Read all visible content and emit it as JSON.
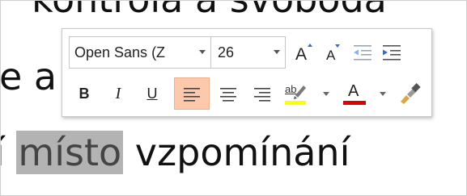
{
  "document": {
    "line1": "kontrola a svoboda",
    "line2": "e a",
    "line3_prefix": "í ",
    "line3_selected": "místo",
    "line3_suffix": " vzpomínání"
  },
  "mini_toolbar": {
    "font_name": "Open Sans (Z",
    "font_size": "26",
    "bold_label": "B",
    "italic_label": "I",
    "underline_label": "U",
    "grow_font_label": "A",
    "shrink_font_label": "A",
    "font_color_label": "A",
    "highlight_label": "ab",
    "icons": {
      "grow_font": "grow-font-icon",
      "shrink_font": "shrink-font-icon",
      "decrease_indent": "decrease-indent-icon",
      "increase_indent": "increase-indent-icon",
      "align_left": "align-left-icon",
      "align_center": "align-center-icon",
      "align_right": "align-right-icon",
      "highlight": "highlight-color-icon",
      "font_color": "font-color-icon",
      "format_painter": "format-painter-icon"
    },
    "colors": {
      "highlight": "#ffff00",
      "font_color": "#e00000",
      "active_bg": "#fcc9ad",
      "selection": "#b3b3b3"
    },
    "active_alignment": "left"
  }
}
